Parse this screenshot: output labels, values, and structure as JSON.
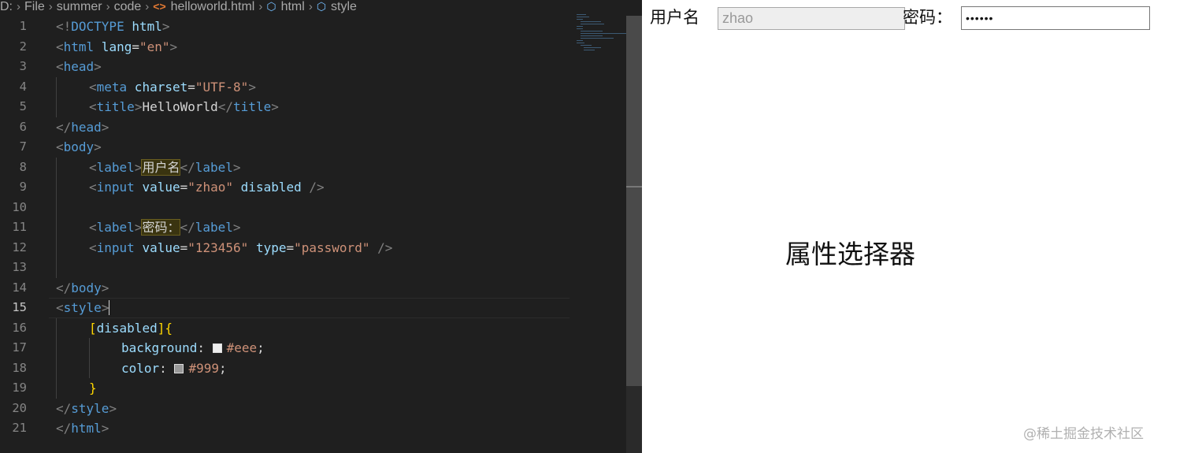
{
  "breadcrumb": {
    "segments": [
      "D:",
      "File",
      "summer",
      "code",
      "helloworld.html",
      "html",
      "style"
    ]
  },
  "editor": {
    "active_line": 15,
    "lines": [
      {
        "n": "1"
      },
      {
        "n": "2"
      },
      {
        "n": "3"
      },
      {
        "n": "4"
      },
      {
        "n": "5"
      },
      {
        "n": "6"
      },
      {
        "n": "7"
      },
      {
        "n": "8"
      },
      {
        "n": "9"
      },
      {
        "n": "10"
      },
      {
        "n": "11"
      },
      {
        "n": "12"
      },
      {
        "n": "13"
      },
      {
        "n": "14"
      },
      {
        "n": "15"
      },
      {
        "n": "16"
      },
      {
        "n": "17"
      },
      {
        "n": "18"
      },
      {
        "n": "19"
      },
      {
        "n": "20"
      },
      {
        "n": "21"
      }
    ],
    "tokens": {
      "l1_open": "<!",
      "l1_kw": "DOCTYPE",
      "l1_html": " html",
      "l1_close": ">",
      "l2_open": "<",
      "l2_tag": "html",
      "l2_attr": " lang",
      "l2_eq": "=",
      "l2_val": "\"en\"",
      "l2_close": ">",
      "l3_open": "<",
      "l3_tag": "head",
      "l3_close": ">",
      "l4_open": "<",
      "l4_tag": "meta",
      "l4_attr": " charset",
      "l4_eq": "=",
      "l4_val": "\"UTF-8\"",
      "l4_close": ">",
      "l5_open": "<",
      "l5_tag": "title",
      "l5_close": ">",
      "l5_text": "HelloWorld",
      "l5_open2": "</",
      "l5_tag2": "title",
      "l5_close2": ">",
      "l6_open": "</",
      "l6_tag": "head",
      "l6_close": ">",
      "l7_open": "<",
      "l7_tag": "body",
      "l7_close": ">",
      "l8_open": "<",
      "l8_tag": "label",
      "l8_close": ">",
      "l8_text": "用户名",
      "l8_open2": "</",
      "l8_tag2": "label",
      "l8_close2": ">",
      "l9_open": "<",
      "l9_tag": "input",
      "l9_attr": " value",
      "l9_eq": "=",
      "l9_val": "\"zhao\"",
      "l9_attr2": " disabled",
      "l9_close": " />",
      "l11_open": "<",
      "l11_tag": "label",
      "l11_close": ">",
      "l11_text": "密码：",
      "l11_open2": "</",
      "l11_tag2": "label",
      "l11_close2": ">",
      "l12_open": "<",
      "l12_tag": "input",
      "l12_attr": " value",
      "l12_eq": "=",
      "l12_val": "\"123456\"",
      "l12_attr2": " type",
      "l12_eq2": "=",
      "l12_val2": "\"password\"",
      "l12_close": " />",
      "l14_open": "</",
      "l14_tag": "body",
      "l14_close": ">",
      "l15_open": "<",
      "l15_tag": "style",
      "l15_close": ">",
      "l16_br1": "[",
      "l16_attr": "disabled",
      "l16_br2": "]{",
      "l17_prop": "background",
      "l17_colon": ": ",
      "l17_val": "#eee",
      "l17_semi": ";",
      "l18_prop": "color",
      "l18_colon": ": ",
      "l18_val": "#999",
      "l18_semi": ";",
      "l19_br": "}",
      "l20_open": "</",
      "l20_tag": "style",
      "l20_close": ">",
      "l21_open": "</",
      "l21_tag": "html",
      "l21_close": ">"
    },
    "swatches": {
      "background": "#eeeeee",
      "color": "#999999"
    }
  },
  "preview": {
    "username_label": "用户名",
    "username_value": "zhao",
    "password_label": "密码：",
    "password_value": "123456",
    "overlay_title": "属性选择器",
    "watermark": "@稀土掘金技术社区"
  },
  "icons": {
    "file_icon": "html-brackets-icon",
    "element_icon": "cube-icon"
  }
}
